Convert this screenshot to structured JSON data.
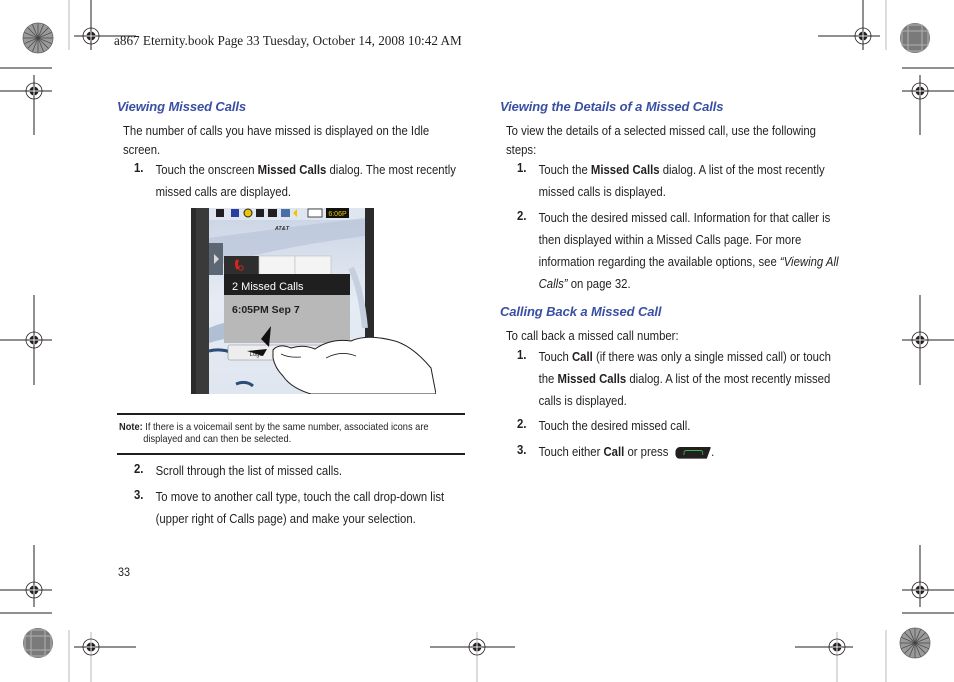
{
  "header": {
    "print_slug": "a867 Eternity.book  Page 33  Tuesday, October 14, 2008  10:42 AM"
  },
  "left_column": {
    "section_title": "Viewing Missed Calls",
    "intro": "The number of calls you have missed is displayed on the Idle screen.",
    "steps": [
      {
        "num": "1.",
        "pre": "Touch the onscreen ",
        "bold": "Missed Calls",
        "post": " dialog. The most recently missed calls are displayed."
      },
      {
        "num": "2.",
        "text": "Scroll through the list of missed calls."
      },
      {
        "num": "3.",
        "text": "To move to another call type, touch the call drop-down list (upper right of Calls page) and make your selection."
      }
    ],
    "screenshot": {
      "status_time": "6:06P",
      "carrier": "AT&T",
      "dialog_title": "2 Missed Calls",
      "dialog_time": "6:05PM Sep 7",
      "logs_button": "Logs"
    },
    "note": {
      "label": "Note:",
      "line1": " If there is a voicemail sent by the same number, associated icons are",
      "line2": "displayed and can then be selected."
    }
  },
  "right_column": {
    "section1_title": "Viewing the Details of a Missed Calls",
    "section1_intro": "To view the details of a selected missed call, use the following steps:",
    "section1_steps": [
      {
        "num": "1.",
        "pre": "Touch the ",
        "bold": "Missed Calls",
        "post": " dialog. A list of the most recently missed calls is displayed."
      },
      {
        "num": "2.",
        "pre": "Touch the desired missed call. Information for that caller is then displayed within a Missed Calls page. For more information regarding the available options, see ",
        "italic": "“Viewing All Calls”",
        "post": " on page 32."
      }
    ],
    "section2_title": "Calling Back a Missed Call",
    "section2_intro": "To call back a missed call number:",
    "section2_steps": [
      {
        "num": "1.",
        "pre": "Touch ",
        "bold": "Call",
        "mid": " (if there was only a single missed call) or touch the ",
        "bold2": "Missed Calls",
        "post": " dialog. A list of the most recently missed calls is displayed."
      },
      {
        "num": "2.",
        "text": "Touch the desired missed call."
      },
      {
        "num": "3.",
        "pre": "Touch either ",
        "bold": "Call",
        "post": " or press ",
        "end": "."
      }
    ]
  },
  "footer": {
    "page_number": "33"
  },
  "icons": {
    "send_key": "send-key-icon",
    "registration_mark": "crosshair-target-icon",
    "color_bar": "starburst-icon"
  }
}
